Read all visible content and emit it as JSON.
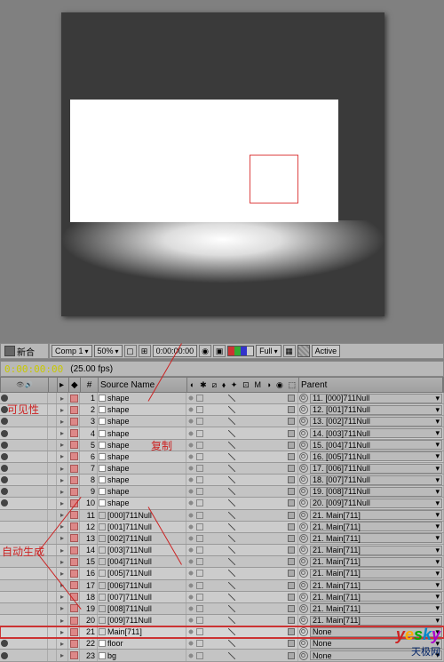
{
  "preview": {
    "comp_tab": "Comp 1",
    "new_comp_label": "新合"
  },
  "toolbar": {
    "zoom": "50%",
    "timecode": "0:00:00:00",
    "resolution": "Full",
    "active": "Active"
  },
  "time": {
    "tc": "0:00:00:00",
    "fps": "(25.00 fps)"
  },
  "headers": {
    "num": "#",
    "source": "Source Name",
    "parent": "Parent"
  },
  "annotations": {
    "visibility": "可见性",
    "duplicate": "复制",
    "autogen": "自动生成"
  },
  "watermark": {
    "brand": "yesky",
    "cn": "天极网"
  },
  "layers": [
    {
      "n": "1",
      "name": "shape",
      "type": "shape",
      "parent": "11. [000]711Null",
      "eye": true
    },
    {
      "n": "2",
      "name": "shape",
      "type": "shape",
      "parent": "12. [001]711Null",
      "eye": true
    },
    {
      "n": "3",
      "name": "shape",
      "type": "shape",
      "parent": "13. [002]711Null",
      "eye": true
    },
    {
      "n": "4",
      "name": "shape",
      "type": "shape",
      "parent": "14. [003]711Null",
      "eye": true
    },
    {
      "n": "5",
      "name": "shape",
      "type": "shape",
      "parent": "15. [004]711Null",
      "eye": true
    },
    {
      "n": "6",
      "name": "shape",
      "type": "shape",
      "parent": "16. [005]711Null",
      "eye": true
    },
    {
      "n": "7",
      "name": "shape",
      "type": "shape",
      "parent": "17. [006]711Null",
      "eye": true
    },
    {
      "n": "8",
      "name": "shape",
      "type": "shape",
      "parent": "18. [007]711Null",
      "eye": true
    },
    {
      "n": "9",
      "name": "shape",
      "type": "shape",
      "parent": "19. [008]711Null",
      "eye": true
    },
    {
      "n": "10",
      "name": "shape",
      "type": "shape",
      "parent": "20. [009]711Null",
      "eye": true
    },
    {
      "n": "11",
      "name": "[000]711Null",
      "type": "null",
      "parent": "21. Main[711]",
      "eye": false
    },
    {
      "n": "12",
      "name": "[001]711Null",
      "type": "null",
      "parent": "21. Main[711]",
      "eye": false
    },
    {
      "n": "13",
      "name": "[002]711Null",
      "type": "null",
      "parent": "21. Main[711]",
      "eye": false
    },
    {
      "n": "14",
      "name": "[003]711Null",
      "type": "null",
      "parent": "21. Main[711]",
      "eye": false
    },
    {
      "n": "15",
      "name": "[004]711Null",
      "type": "null",
      "parent": "21. Main[711]",
      "eye": false
    },
    {
      "n": "16",
      "name": "[005]711Null",
      "type": "null",
      "parent": "21. Main[711]",
      "eye": false
    },
    {
      "n": "17",
      "name": "[006]711Null",
      "type": "null",
      "parent": "21. Main[711]",
      "eye": false
    },
    {
      "n": "18",
      "name": "[007]711Null",
      "type": "null",
      "parent": "21. Main[711]",
      "eye": false
    },
    {
      "n": "19",
      "name": "[008]711Null",
      "type": "null",
      "parent": "21. Main[711]",
      "eye": false
    },
    {
      "n": "20",
      "name": "[009]711Null",
      "type": "null",
      "parent": "21. Main[711]",
      "eye": false
    },
    {
      "n": "21",
      "name": "Main[711]",
      "type": "main",
      "parent": "None",
      "eye": false,
      "hl": true
    },
    {
      "n": "22",
      "name": "floor",
      "type": "shape",
      "parent": "None",
      "eye": true
    },
    {
      "n": "23",
      "name": "bg",
      "type": "shape",
      "parent": "None",
      "eye": true
    }
  ]
}
